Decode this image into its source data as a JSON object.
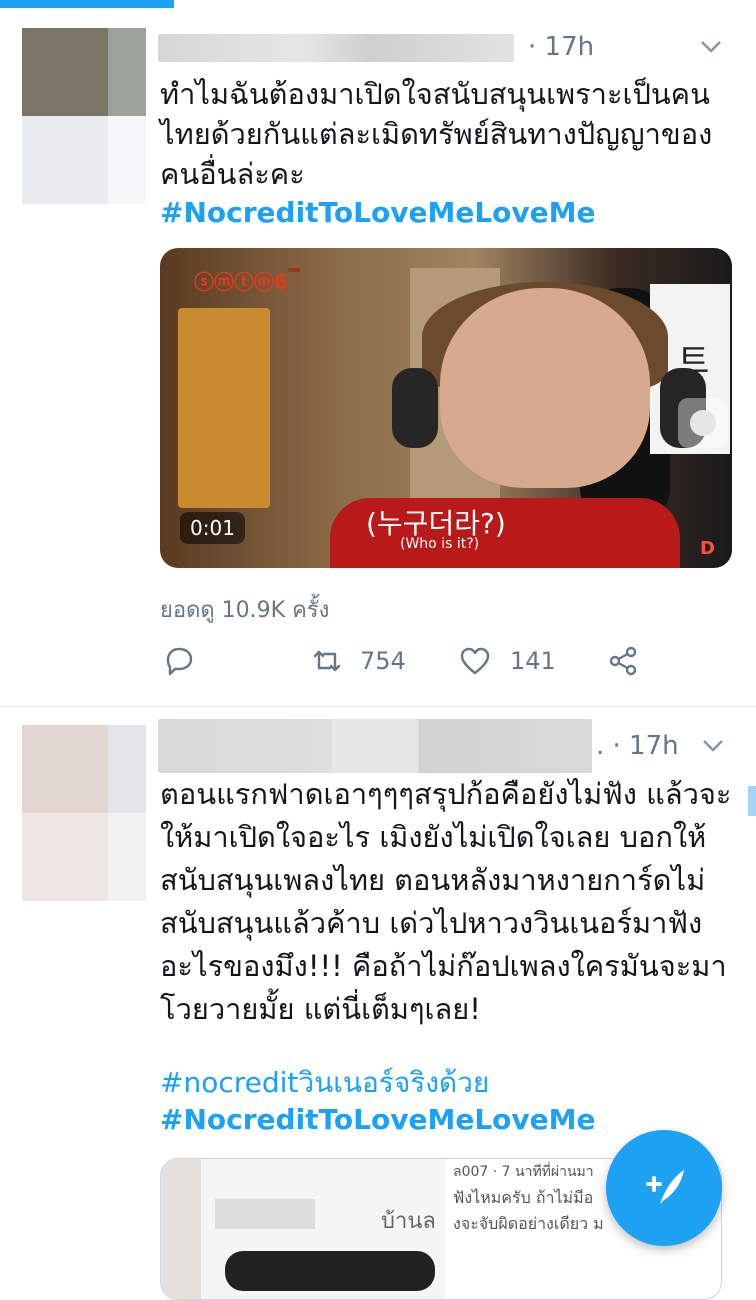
{
  "progress": {
    "fraction": 0.23
  },
  "tweet1": {
    "time": "· 17h",
    "text": "ทำไมฉันต้องมาเปิดใจสนับสนุนเพราะเป็นคนไทยด้วยกันแต่ละเมิดทรัพย์สินทางปัญญาของคนอื่นล่ะคะ",
    "hashtag": "#NocreditToLoveMeLoveMe",
    "video": {
      "duration": "0:01",
      "subtitle_ko": "(누구더라?)",
      "subtitle_en": "(Who is it?)",
      "card_char": "트"
    },
    "views": "ยอดดู 10.9K ครั้ง",
    "retweets": "754",
    "likes": "141"
  },
  "tweet2": {
    "time": ". · 17h",
    "text": "ตอนแรกฟาดเอาๆๆๆสรุปก้อคือยังไม่ฟัง แล้วจะให้มาเปิดใจอะไร เมิงยังไม่เปิดใจเลย บอกให้สนับสนุนเพลงไทย ตอนหลังมาหงายการ์ดไม่สนับสนุนแล้วค้าบ เด่วไปหาวงวินเนอร์มาฟัง อะไรของมึง!!! คือถ้าไม่ก๊อปเพลงใครมันจะมาโวยวายมั้ย แต่นี่เต็มๆเลย!",
    "hashtag1": "#nocreditวินเนอร์จริงด้วย",
    "hashtag2": "#NocreditToLoveMeLoveMe",
    "quote_img_text": "บ้านล",
    "quote_side_line1": "ล007 · 7 นาทีที่ผ่านมา",
    "quote_side_line2": "ฟังไหมครับ ถ้าไม่มีอ",
    "quote_side_line3": "งจะจับผิดอย่างเดียว ม"
  },
  "icons": {
    "reply": "reply-icon",
    "retweet": "retweet-icon",
    "like": "heart-icon",
    "share": "share-icon",
    "compose": "compose-tweet-icon",
    "caret": "chevron-down-icon"
  },
  "colors": {
    "accent": "#1da1f2",
    "muted": "#657786"
  }
}
